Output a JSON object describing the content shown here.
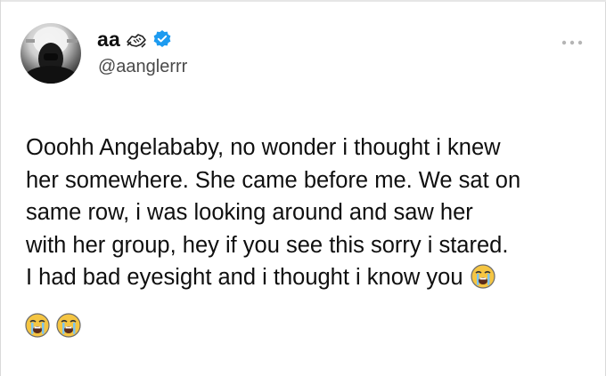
{
  "author": {
    "display_name": "aa",
    "handle": "@aanglerrr",
    "name_emoji_icon": "handshake-emoji-icon",
    "verified_icon": "verified-badge-icon",
    "avatar": "profile-avatar"
  },
  "menu": {
    "icon": "more-options-icon"
  },
  "tweet": {
    "lines": [
      "Ooohh Angelababy, no wonder i thought i knew",
      "her somewhere. She came before me. We sat on",
      "same row, i was looking around and saw her",
      "with her group, hey if you see this sorry i stared.",
      "I had bad eyesight and i thought i know you"
    ],
    "emojis": [
      "loudly-crying-face-emoji-icon",
      "loudly-crying-face-emoji-icon",
      "loudly-crying-face-emoji-icon"
    ]
  },
  "colors": {
    "verified": "#1d9bf0",
    "text": "#0f0f0f",
    "handle": "#4a4a4a",
    "emoji_face": "#f5c542"
  }
}
